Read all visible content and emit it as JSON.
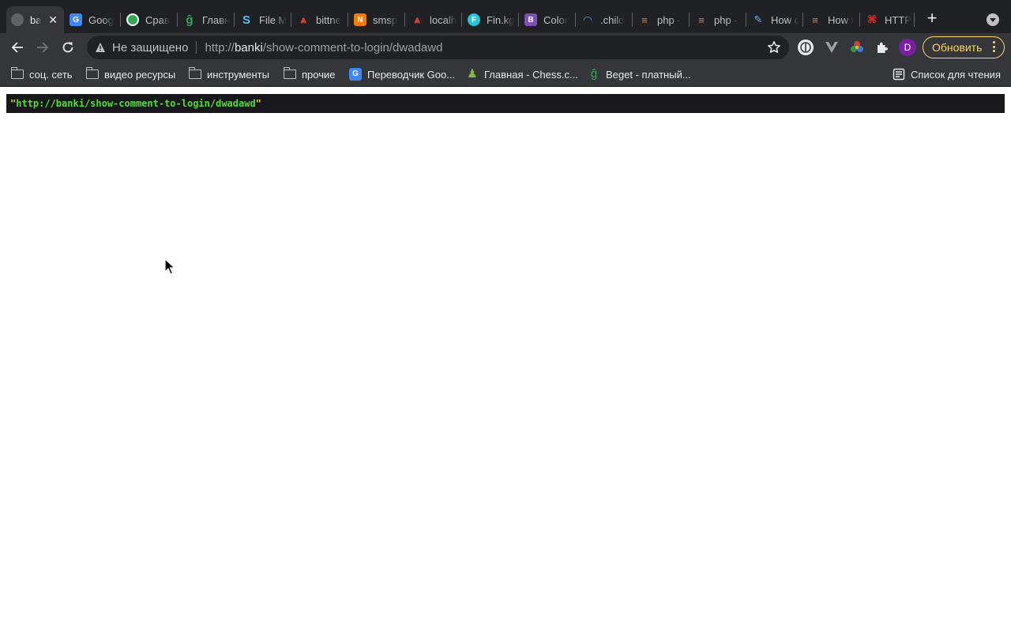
{
  "tabs": [
    {
      "title": "ba",
      "favicon": "globe-icon",
      "color": "#5f6368",
      "active": true
    },
    {
      "title": "Goog",
      "favicon": "google-translate-icon",
      "color": "#4285f4"
    },
    {
      "title": "Срав",
      "favicon": "compass-icon",
      "color": "#ffffff"
    },
    {
      "title": "Главн",
      "favicon": "beget-icon",
      "color": "#34a853"
    },
    {
      "title": "File M",
      "favicon": "file-manager-icon",
      "color": "#4fc3f7"
    },
    {
      "title": "bittne",
      "favicon": "gitlab-icon",
      "color": "#e24329"
    },
    {
      "title": "smsp",
      "favicon": "n-icon",
      "color": "#f57c00"
    },
    {
      "title": "localh",
      "favicon": "gitlab-icon",
      "color": "#e24329"
    },
    {
      "title": "Fin.kg",
      "favicon": "f-icon",
      "color": "#26c6da"
    },
    {
      "title": "Color",
      "favicon": "bootstrap-icon",
      "color": "#7952b3"
    },
    {
      "title": ".child",
      "favicon": "wave-icon",
      "color": "#4a90e2"
    },
    {
      "title": "php -",
      "favicon": "stackoverflow-icon",
      "color": "#f48024"
    },
    {
      "title": "php -",
      "favicon": "stackoverflow-icon",
      "color": "#f48024"
    },
    {
      "title": "How c",
      "favicon": "pen-icon",
      "color": "#64b5f6"
    },
    {
      "title": "How t",
      "favicon": "stackoverflow-icon",
      "color": "#f48024"
    },
    {
      "title": "HTTP",
      "favicon": "laravel-icon",
      "color": "#ff2d20"
    }
  ],
  "toolbar": {
    "security_label": "Не защищено",
    "url_scheme": "http://",
    "url_host": "banki",
    "url_path": "/show-comment-to-login/dwadawd",
    "avatar_letter": "D",
    "update_label": "Обновить"
  },
  "bookmarks": [
    {
      "label": "соц. сеть",
      "icon": "folder-icon"
    },
    {
      "label": "видео ресурсы",
      "icon": "folder-icon"
    },
    {
      "label": "инструменты",
      "icon": "folder-icon"
    },
    {
      "label": "прочие",
      "icon": "folder-icon"
    },
    {
      "label": "Переводчик Goo...",
      "icon": "google-translate-icon"
    },
    {
      "label": "Главная - Chess.c...",
      "icon": "chess-pawn-icon"
    },
    {
      "label": "Beget - платный...",
      "icon": "beget-icon"
    }
  ],
  "reading_list_label": "Список для чтения",
  "page": {
    "quote": "\"",
    "dump_value": "http://banki/show-comment-to-login/dwadawd"
  },
  "colors": {
    "dump_background": "#18171b",
    "dump_string": "#56db3a",
    "dump_quote": "#ffd21a",
    "update_accent": "#fdd663"
  }
}
